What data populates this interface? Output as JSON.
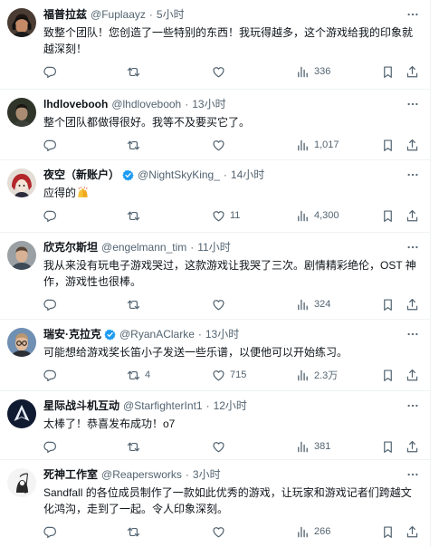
{
  "separator": "·",
  "colors": {
    "text": "#0f1419",
    "secondary": "#536471",
    "divider": "#eff3f4",
    "verified": "#1d9bf0"
  },
  "icons": {
    "reply": "reply-icon",
    "retweet": "retweet-icon",
    "like": "heart-icon",
    "views": "views-chart-icon",
    "bookmark": "bookmark-icon",
    "share": "share-icon",
    "more": "more-options-icon",
    "verified": "verified-badge-icon"
  },
  "tweets": [
    {
      "name": "福普拉兹",
      "verified": false,
      "handle": "@Fuplaayz",
      "time": "5小时",
      "lines": [
        "致整个团队！您创造了一些特别的东西！我玩得越多，这个游戏给我的印象就",
        "越深刻！"
      ],
      "views": "336"
    },
    {
      "name": "lhdlovebooh",
      "verified": false,
      "handle": "@lhdlovebooh",
      "time": "13小时",
      "lines": [
        "整个团队都做得很好。我等不及要买它了。"
      ],
      "views": "1,017"
    },
    {
      "name": "夜空（新账户）",
      "verified": true,
      "handle": "@NightSkyKing_",
      "time": "14小时",
      "lines": [
        "应得的"
      ],
      "emoji": "raising-hands",
      "likes": "11",
      "views": "4,300"
    },
    {
      "name": "欣克尔斯坦",
      "verified": false,
      "handle": "@engelmann_tim",
      "time": "11小时",
      "lines": [
        "我从来没有玩电子游戏哭过，这款游戏让我哭了三次。剧情精彩绝伦，OST 神",
        "作，游戏性也很棒。"
      ],
      "views": "324"
    },
    {
      "name": "瑞安·克拉克",
      "verified": true,
      "handle": "@RyanAClarke",
      "time": "13小时",
      "lines": [
        "可能想给游戏奖长笛小子发送一些乐谱，以便他可以开始练习。"
      ],
      "retweets": "4",
      "likes": "715",
      "views": "2.3万"
    },
    {
      "name": "星际战斗机互动",
      "verified": false,
      "handle": "@StarfighterInt1",
      "time": "12小时",
      "lines": [
        "太棒了！恭喜发布成功！o7"
      ],
      "views": "381"
    },
    {
      "name": "死神工作室",
      "verified": false,
      "handle": "@Reapersworks",
      "time": "3小时",
      "lines": [
        "Sandfall 的各位成员制作了一款如此优秀的游戏，让玩家和游戏记者们跨越文",
        "化鸿沟，走到了一起。令人印象深刻。"
      ],
      "views": "266"
    }
  ]
}
